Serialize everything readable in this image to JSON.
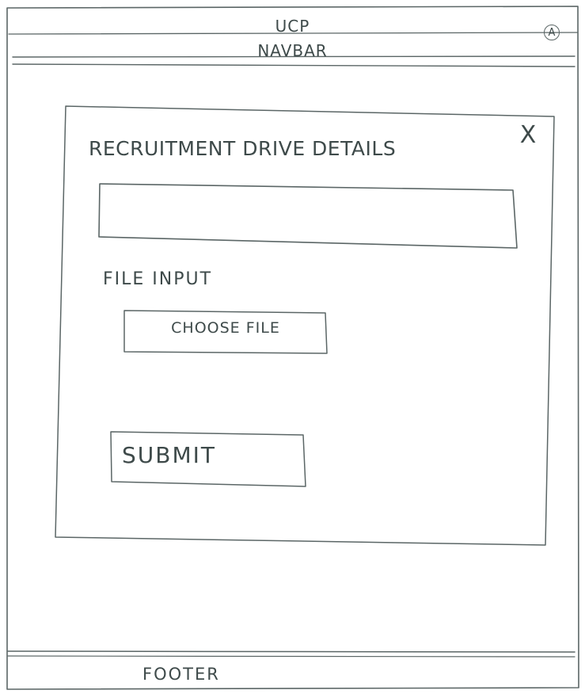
{
  "header": {
    "title": "UCP",
    "avatar_letter": "A"
  },
  "navbar": {
    "label": "NAVBAR"
  },
  "modal": {
    "title": "RECRUITMENT DRIVE DETAILS",
    "close_symbol": "X",
    "text_input": {
      "value": "",
      "placeholder": ""
    },
    "file_input_label": "FILE INPUT",
    "choose_file_label": "CHOOSE FILE",
    "submit_label": "SUBMIT"
  },
  "footer": {
    "label": "FOOTER"
  }
}
